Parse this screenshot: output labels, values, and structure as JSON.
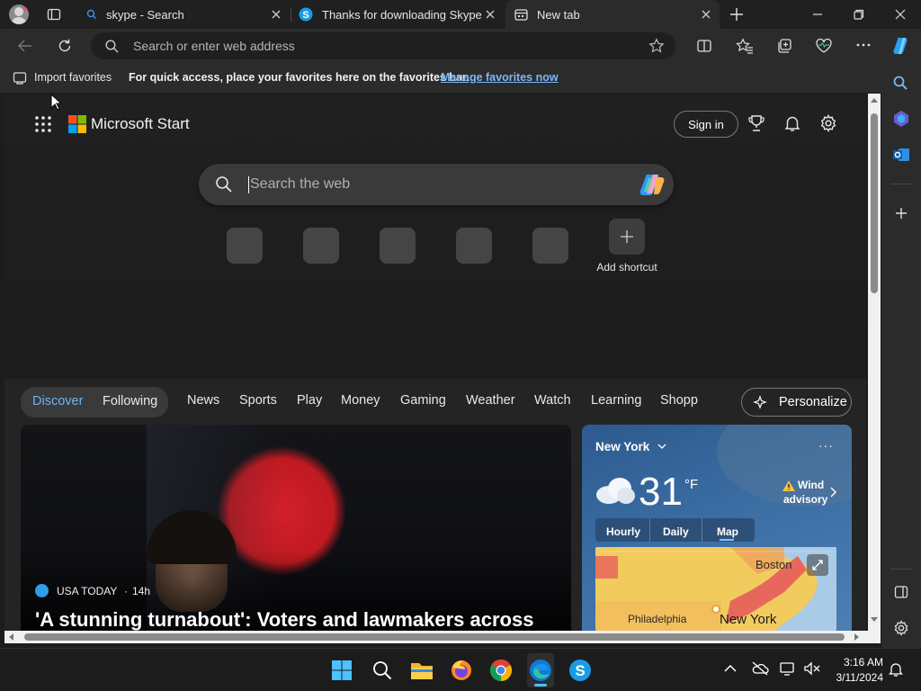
{
  "tabs": [
    {
      "title": "skype - Search",
      "icon": "search-icon"
    },
    {
      "title": "Thanks for downloading Skype",
      "icon": "skype-icon"
    },
    {
      "title": "New tab",
      "icon": "new-tab-icon",
      "active": true
    }
  ],
  "address_bar": {
    "placeholder": "Search or enter web address"
  },
  "favorites_bar": {
    "import_label": "Import favorites",
    "hint": "For quick access, place your favorites here on the favorites bar.",
    "manage_link": "Manage favorites now"
  },
  "page": {
    "brand": "Microsoft Start",
    "sign_in": "Sign in",
    "search_placeholder": "Search the web",
    "add_shortcut": "Add shortcut",
    "tabs": {
      "discover": "Discover",
      "following": "Following"
    },
    "nav": [
      "News",
      "Sports",
      "Play",
      "Money",
      "Gaming",
      "Weather",
      "Watch",
      "Learning",
      "Shopp"
    ],
    "personalize": "Personalize",
    "news": {
      "source": "USA TODAY",
      "age": "14h",
      "headline": "'A stunning turnabout': Voters and lawmakers across"
    },
    "weather": {
      "city": "New York",
      "temp": "31",
      "unit": "°F",
      "alert_line1": "Wind",
      "alert_line2": "advisory",
      "tabs": [
        "Hourly",
        "Daily",
        "Map"
      ],
      "map_labels": {
        "boston": "Boston",
        "philadelphia": "Philadelphia",
        "new_york": "New York"
      }
    }
  },
  "taskbar": {
    "time": "3:16 AM",
    "date": "3/11/2024"
  },
  "colors": {
    "accent": "#4aa0e6",
    "link": "#7cb7f5",
    "page_bg": "#242424"
  }
}
